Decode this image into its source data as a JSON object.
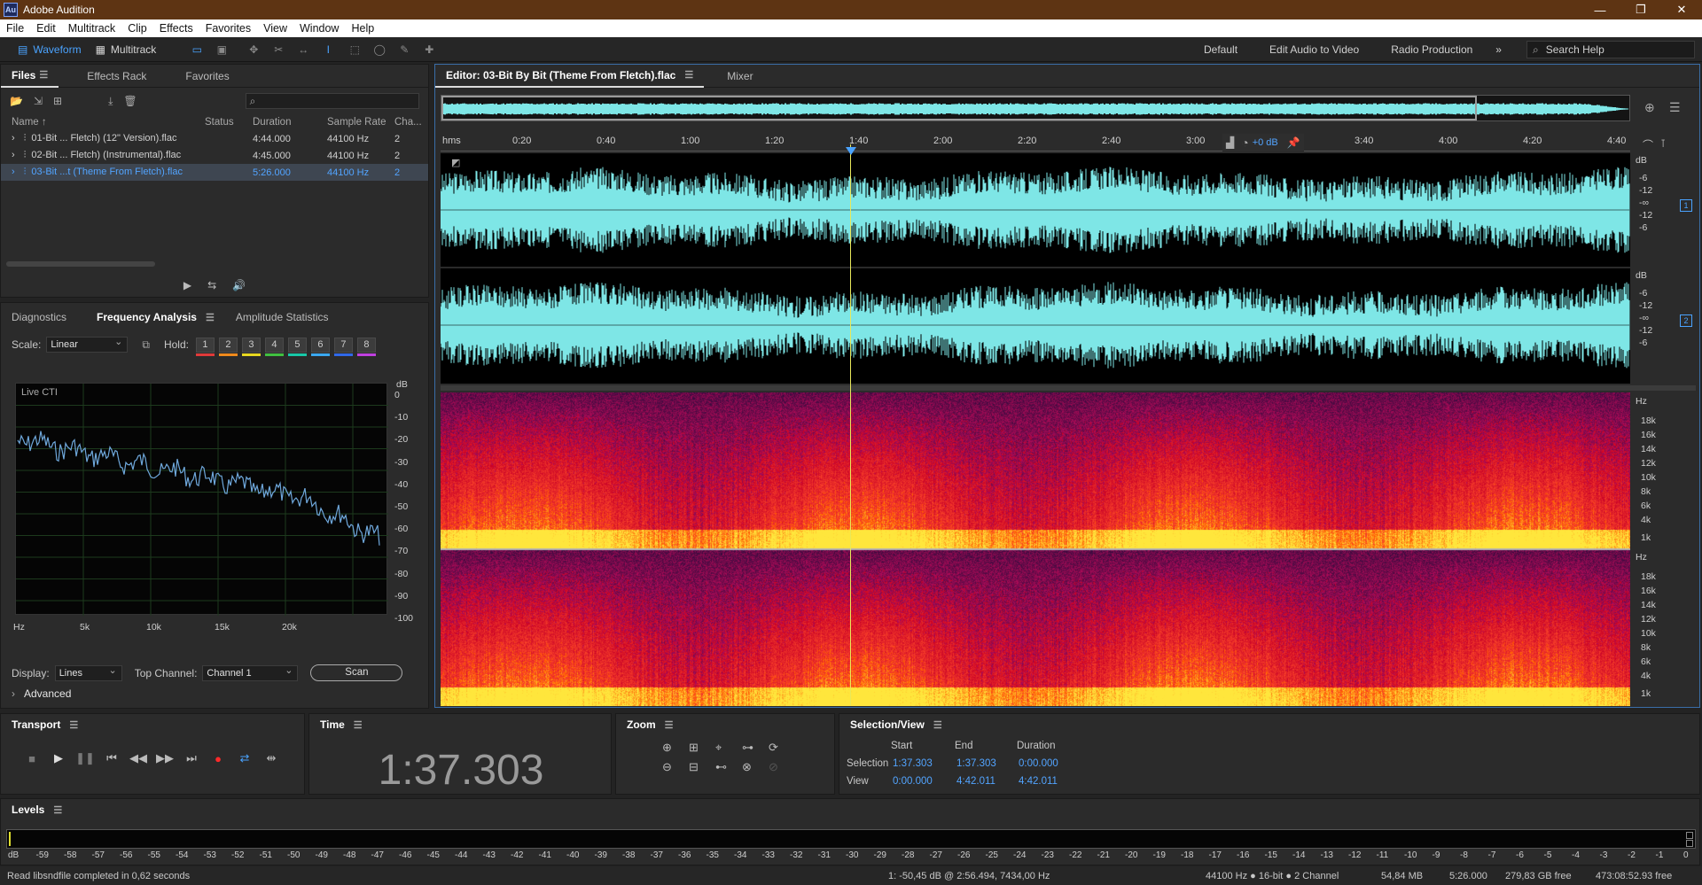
{
  "window": {
    "app_badge": "Au",
    "title": "Adobe Audition",
    "minimize": "—",
    "maximize": "❐",
    "close": "✕"
  },
  "menu": [
    "File",
    "Edit",
    "Multitrack",
    "Clip",
    "Effects",
    "Favorites",
    "View",
    "Window",
    "Help"
  ],
  "toolbar": {
    "waveform": "Waveform",
    "multitrack": "Multitrack",
    "workspaces": [
      "Default",
      "Edit Audio to Video",
      "Radio Production"
    ],
    "more": "»",
    "search_placeholder": "Search Help"
  },
  "files_panel": {
    "tabs": [
      "Files",
      "Effects Rack",
      "Favorites"
    ],
    "columns": [
      "Name ↑",
      "Status",
      "Duration",
      "Sample Rate",
      "Cha..."
    ],
    "rows": [
      {
        "name": "01-Bit ... Fletch) (12\" Version).flac",
        "duration": "4:44.000",
        "sample_rate": "44100 Hz",
        "channels": "2",
        "selected": false
      },
      {
        "name": "02-Bit ... Fletch) (Instrumental).flac",
        "duration": "4:45.000",
        "sample_rate": "44100 Hz",
        "channels": "2",
        "selected": false
      },
      {
        "name": "03-Bit ...t (Theme From Fletch).flac",
        "duration": "5:26.000",
        "sample_rate": "44100 Hz",
        "channels": "2",
        "selected": true
      }
    ]
  },
  "analysis_panel": {
    "tabs": [
      "Diagnostics",
      "Frequency Analysis",
      "Amplitude Statistics"
    ],
    "scale_label": "Scale:",
    "scale_value": "Linear",
    "hold_label": "Hold:",
    "hold": [
      "1",
      "2",
      "3",
      "4",
      "5",
      "6",
      "7",
      "8"
    ],
    "hold_colors": [
      "#e03a3a",
      "#f08a1c",
      "#e8d820",
      "#40c040",
      "#18c8a8",
      "#3aa8f0",
      "#3068e8",
      "#c040e0"
    ],
    "graph_label": "Live CTI",
    "db_ticks": [
      "dB",
      "0",
      "-10",
      "-20",
      "-30",
      "-40",
      "-50",
      "-60",
      "-70",
      "-80",
      "-90",
      "-100"
    ],
    "hz_ticks": [
      "Hz",
      "5k",
      "10k",
      "15k",
      "20k"
    ],
    "display_label": "Display:",
    "display_value": "Lines",
    "top_channel_label": "Top Channel:",
    "top_channel_value": "Channel 1",
    "scan": "Scan",
    "advanced": "Advanced"
  },
  "editor": {
    "tab": "Editor: 03-Bit By Bit (Theme From Fletch).flac",
    "mixer_tab": "Mixer",
    "ruler": [
      "hms",
      "0:20",
      "0:40",
      "1:00",
      "1:20",
      "1:40",
      "2:00",
      "2:20",
      "2:40",
      "3:00",
      "3:20",
      "3:40",
      "4:00",
      "4:20",
      "4:40"
    ],
    "gain": "+0 dB",
    "wave_db": [
      "dB",
      "-6",
      "-12",
      "-∞",
      "-12",
      "-6"
    ],
    "channels": [
      "1",
      "2"
    ],
    "hz_labels": [
      "Hz",
      "18k",
      "16k",
      "14k",
      "12k",
      "10k",
      "8k",
      "6k",
      "4k",
      "1k"
    ],
    "colors": {
      "waveform": "#7ee6e6",
      "accent": "#4aa3ff"
    }
  },
  "transport": {
    "title": "Transport",
    "controls": [
      "■",
      "▶",
      "❚❚",
      "⏮",
      "◀◀",
      "▶▶",
      "⏭",
      "●",
      "⇄",
      "⇹"
    ]
  },
  "time": {
    "title": "Time",
    "value": "1:37.303"
  },
  "zoom": {
    "title": "Zoom"
  },
  "selection_view": {
    "title": "Selection/View",
    "headers": [
      "Start",
      "End",
      "Duration"
    ],
    "selection_label": "Selection",
    "view_label": "View",
    "selection": [
      "1:37.303",
      "1:37.303",
      "0:00.000"
    ],
    "view": [
      "0:00.000",
      "4:42.011",
      "4:42.011"
    ]
  },
  "levels": {
    "title": "Levels",
    "scale": [
      "dB",
      "-59",
      "-58",
      "-57",
      "-56",
      "-55",
      "-54",
      "-53",
      "-52",
      "-51",
      "-50",
      "-49",
      "-48",
      "-47",
      "-46",
      "-45",
      "-44",
      "-43",
      "-42",
      "-41",
      "-40",
      "-39",
      "-38",
      "-37",
      "-36",
      "-35",
      "-34",
      "-33",
      "-32",
      "-31",
      "-30",
      "-29",
      "-28",
      "-27",
      "-26",
      "-25",
      "-24",
      "-23",
      "-22",
      "-21",
      "-20",
      "-19",
      "-18",
      "-17",
      "-16",
      "-15",
      "-14",
      "-13",
      "-12",
      "-11",
      "-10",
      "-9",
      "-8",
      "-7",
      "-6",
      "-5",
      "-4",
      "-3",
      "-2",
      "-1",
      "0"
    ]
  },
  "status": {
    "message": "Read libsndfile completed in 0,62 seconds",
    "cursor_info": "1: -50,45 dB @ 2:56.494, 7434,00 Hz",
    "format": "44100 Hz ● 16-bit ● 2 Channel",
    "size": "54,84 MB",
    "duration": "5:26.000",
    "free": "279,83 GB free",
    "free_time": "473:08:52.93 free"
  }
}
